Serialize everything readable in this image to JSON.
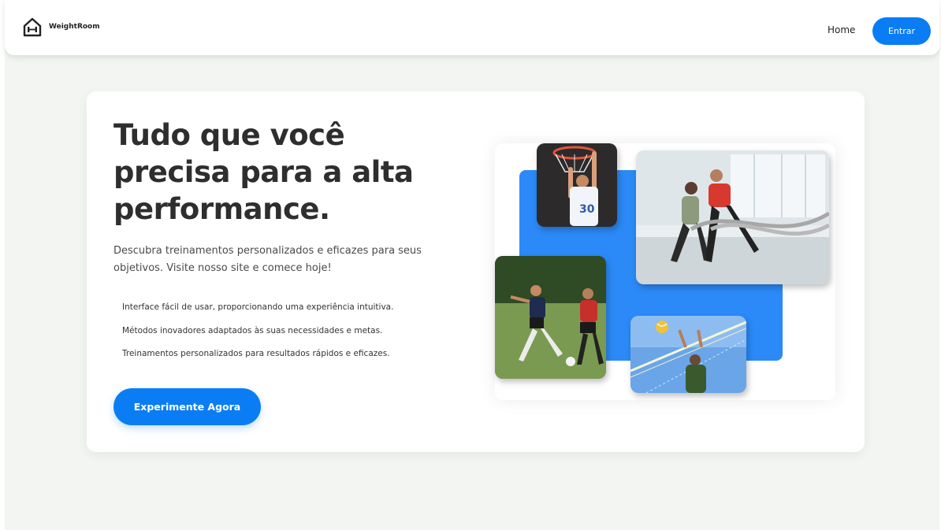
{
  "navbar": {
    "brand_name": "WeightRoom",
    "brand_icon": "dumbbell-house-icon",
    "home_label": "Home",
    "login_label": "Entrar"
  },
  "hero": {
    "title": "Tudo que você precisa para a alta performance.",
    "description": "Descubra treinamentos personalizados e eficazes para seus objetivos. Visite nosso site e comece hoje!",
    "features": [
      "Interface fácil de usar, proporcionando uma experiência intuitiva.",
      "Métodos inovadores adaptados às suas necessidades e metas.",
      "Treinamentos personalizados para resultados rápidos e eficazes."
    ],
    "cta_label": "Experimente Agora"
  },
  "collage": {
    "photos": [
      {
        "subject": "basketball-photo"
      },
      {
        "subject": "gym-battle-ropes-photo"
      },
      {
        "subject": "soccer-photo"
      },
      {
        "subject": "volleyball-photo"
      }
    ]
  },
  "colors": {
    "accent": "#0a7df5",
    "accent_block": "#2b8af7",
    "page_background": "#f2f5f1",
    "text_dark": "#2e2e2e"
  }
}
